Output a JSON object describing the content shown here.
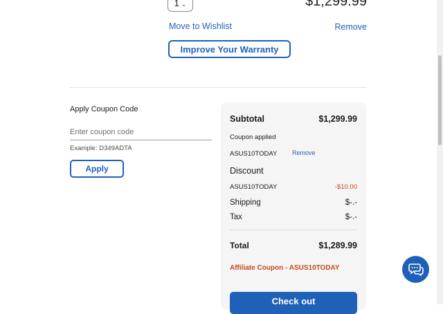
{
  "product": {
    "quantity": "1",
    "price": "$1,299.99",
    "wishlist_label": "Move to Wishlist",
    "remove_label": "Remove",
    "warranty_label": "Improve Your Warranty"
  },
  "coupon": {
    "title": "Apply Coupon Code",
    "placeholder": "Enter coupon code",
    "value": "",
    "example": "Example: D349ADTA",
    "apply_label": "Apply"
  },
  "summary": {
    "subtotal_label": "Subtotal",
    "subtotal_value": "$1,299.99",
    "coupon_applied_label": "Coupon applied",
    "coupon_code": "ASUS10TODAY",
    "coupon_remove_label": "Remove",
    "discount_label": "Discount",
    "discount_code": "ASUS10TODAY",
    "discount_value": "-$10.00",
    "shipping_label": "Shipping",
    "shipping_value": "$-.-",
    "tax_label": "Tax",
    "tax_value": "$-.-",
    "total_label": "Total",
    "total_value": "$1,289.99",
    "affiliate_text": "Affiliate Coupon - ASUS10TODAY",
    "checkout_label": "Check out"
  },
  "colors": {
    "accent": "#1f61b8",
    "discount": "#c24a1e",
    "panel": "#f5f5f5"
  },
  "icons": {
    "quantity_dropdown": "chevron-down-icon",
    "chat": "chat-icon"
  }
}
